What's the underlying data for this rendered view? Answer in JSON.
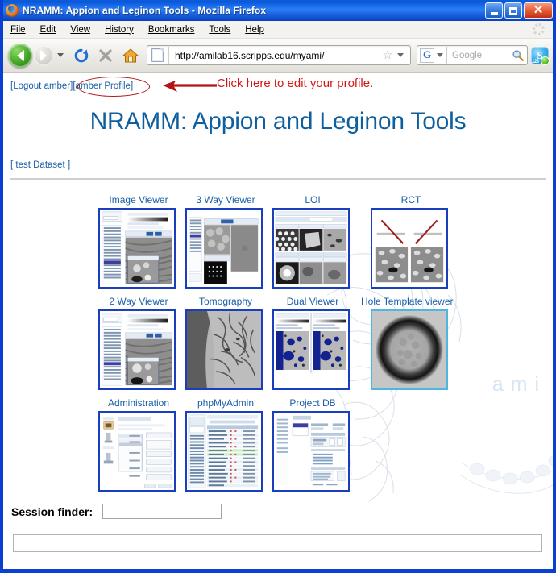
{
  "window": {
    "title": "NRAMM: Appion and Leginon Tools - Mozilla Firefox",
    "minimize_label": "",
    "maximize_label": "",
    "close_label": "✕"
  },
  "menubar": {
    "items": [
      {
        "label": "File"
      },
      {
        "label": "Edit"
      },
      {
        "label": "View"
      },
      {
        "label": "History"
      },
      {
        "label": "Bookmarks"
      },
      {
        "label": "Tools"
      },
      {
        "label": "Help"
      }
    ]
  },
  "toolbar": {
    "url": "http://amilab16.scripps.edu/myami/",
    "search_placeholder": "Google",
    "search_engine_letter": "G",
    "skype_letter": "S",
    "skype_badge_number": "123"
  },
  "page": {
    "logout_link": "[Logout amber]",
    "profile_link": "[amber Profile]",
    "annotation": "Click here to edit your profile.",
    "title": "NRAMM: Appion and Leginon Tools",
    "dataset": "[ test Dataset ]",
    "watermark_text": "ami",
    "session_finder_label": "Session finder:",
    "session_finder_value": "",
    "session_finder_placeholder": "",
    "bottom_field_value": "",
    "bottom_field_placeholder": ""
  },
  "tools": {
    "rows": [
      [
        {
          "label": "Image Viewer",
          "thumb": "image-viewer",
          "border": "blue"
        },
        {
          "label": "3 Way Viewer",
          "thumb": "three-way-viewer",
          "border": "blue"
        },
        {
          "label": "LOI",
          "thumb": "loi",
          "border": "blue"
        },
        {
          "label": "RCT",
          "thumb": "rct",
          "border": "blue"
        }
      ],
      [
        {
          "label": "2 Way Viewer",
          "thumb": "two-way-viewer",
          "border": "blue"
        },
        {
          "label": "Tomography",
          "thumb": "tomography",
          "border": "blue"
        },
        {
          "label": "Dual Viewer",
          "thumb": "dual-viewer",
          "border": "blue"
        },
        {
          "label": "Hole Template viewer",
          "thumb": "hole-template-viewer",
          "border": "cyan"
        }
      ],
      [
        {
          "label": "Administration",
          "thumb": "administration",
          "border": "blue"
        },
        {
          "label": "phpMyAdmin",
          "thumb": "phpmyadmin",
          "border": "blue"
        },
        {
          "label": "Project DB",
          "thumb": "project-db",
          "border": "blue"
        }
      ]
    ]
  },
  "colors": {
    "title_blue": "#0f5f9e",
    "link_blue": "#1b5fa8",
    "annotation_red": "#d31616",
    "thumb_border": "#1a3fbe",
    "thumb_border_cyan": "#4fb6e0",
    "window_frame": "#0b3fd1"
  }
}
